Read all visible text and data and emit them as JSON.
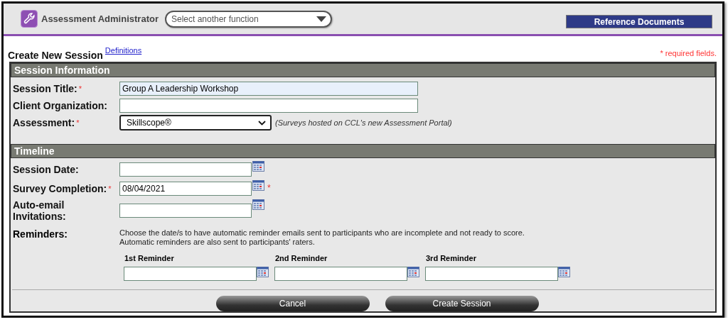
{
  "header": {
    "app_title": "Assessment Administrator",
    "function_select": {
      "placeholder": "Select another function"
    },
    "reference_button": "Reference Documents"
  },
  "page": {
    "title": "Create New Session",
    "definitions_link": "Definitions",
    "required_note": "* required fields."
  },
  "session_information": {
    "heading": "Session Information",
    "fields": [
      {
        "kind": "text",
        "label": "Session Title:",
        "marker": "*",
        "value": "Group A Leadership Workshop",
        "highlighted": true
      },
      {
        "kind": "text",
        "label": "Client Organization:",
        "highlighted": false
      },
      {
        "kind": "select",
        "label": "Assessment:",
        "marker": "*",
        "value": "Skillscope®",
        "note": "(Surveys hosted on CCL's new Assessment Portal)"
      }
    ]
  },
  "timeline": {
    "heading": "Timeline",
    "fields": [
      {
        "kind": "date",
        "label": "Session Date:"
      },
      {
        "kind": "date",
        "label": "Survey Completion:",
        "marker": "*",
        "value": "08/04/2021",
        "trailing_marker": "*"
      },
      {
        "kind": "date",
        "label": "Auto-email Invitations:"
      }
    ],
    "reminders": {
      "label": "Reminders:",
      "instructions": [
        "Choose the date/s to have automatic reminder emails sent to participants who are incomplete and not ready to score.",
        "Automatic reminders are also sent to participants' raters."
      ],
      "items": [
        {
          "label": "1st Reminder"
        },
        {
          "label": "2nd Reminder"
        },
        {
          "label": "3rd Reminder"
        }
      ]
    }
  },
  "buttons": [
    "Cancel",
    "Create Session"
  ]
}
